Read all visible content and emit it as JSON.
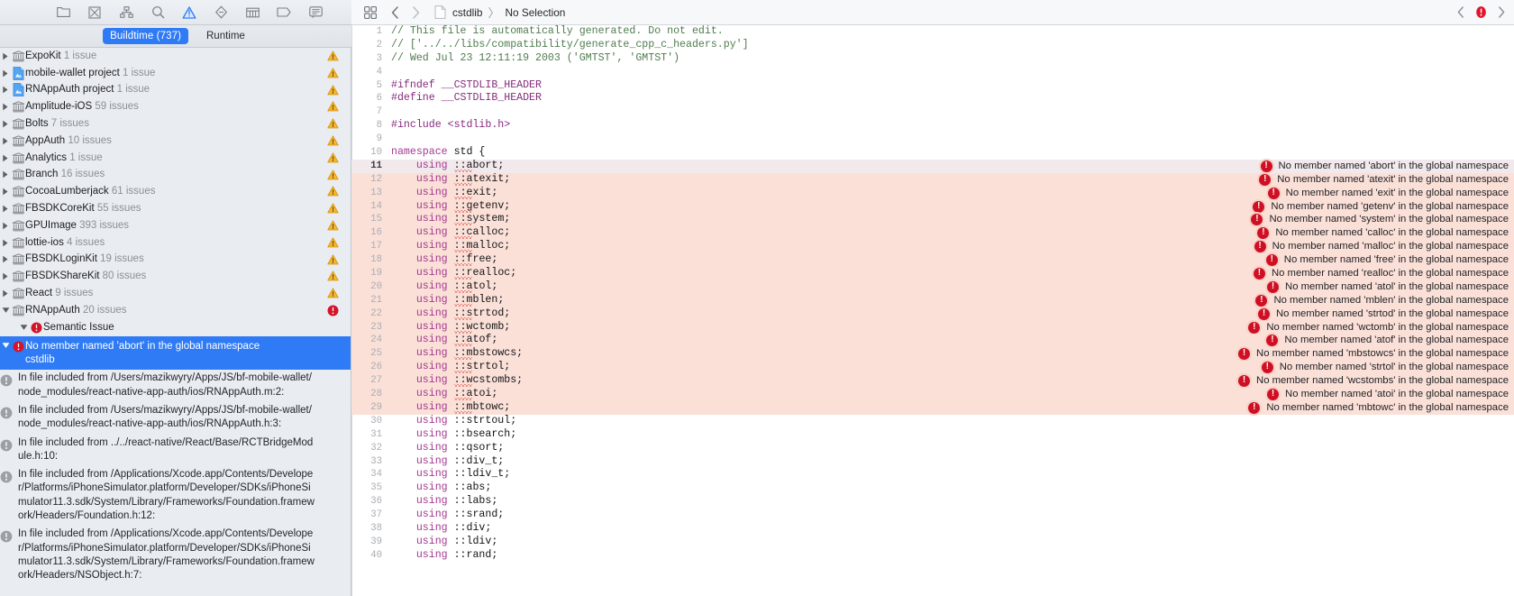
{
  "navigator": {
    "toolbar_icons": [
      {
        "name": "folder-icon",
        "title": "Project navigator"
      },
      {
        "name": "source-control-icon",
        "title": "Source control navigator"
      },
      {
        "name": "symbol-hierarchy-icon",
        "title": "Symbol navigator"
      },
      {
        "name": "search-icon",
        "title": "Find navigator"
      },
      {
        "name": "warning-triangle-icon",
        "title": "Issue navigator"
      },
      {
        "name": "test-diamond-icon",
        "title": "Test navigator"
      },
      {
        "name": "debug-gauge-icon",
        "title": "Debug navigator"
      },
      {
        "name": "breakpoint-tag-icon",
        "title": "Breakpoint navigator"
      },
      {
        "name": "report-bubble-icon",
        "title": "Report navigator"
      }
    ],
    "scope": {
      "buildtime_label": "Buildtime (737)",
      "runtime_label": "Runtime",
      "selected": "Buildtime (737)"
    },
    "groups": [
      {
        "label": "ExpoKit",
        "count": "1 issue",
        "icon": "library-icon",
        "flag": "warning",
        "expanded": false
      },
      {
        "label": "mobile-wallet project",
        "count": "1 issue",
        "icon": "project-icon",
        "flag": "warning",
        "expanded": false
      },
      {
        "label": "RNAppAuth project",
        "count": "1 issue",
        "icon": "project-icon",
        "flag": "warning",
        "expanded": false
      },
      {
        "label": "Amplitude-iOS",
        "count": "59 issues",
        "icon": "library-icon",
        "flag": "warning",
        "expanded": false
      },
      {
        "label": "Bolts",
        "count": "7 issues",
        "icon": "library-icon",
        "flag": "warning",
        "expanded": false
      },
      {
        "label": "AppAuth",
        "count": "10 issues",
        "icon": "library-icon",
        "flag": "warning",
        "expanded": false
      },
      {
        "label": "Analytics",
        "count": "1 issue",
        "icon": "library-icon",
        "flag": "warning",
        "expanded": false
      },
      {
        "label": "Branch",
        "count": "16 issues",
        "icon": "library-icon",
        "flag": "warning",
        "expanded": false
      },
      {
        "label": "CocoaLumberjack",
        "count": "61 issues",
        "icon": "library-icon",
        "flag": "warning",
        "expanded": false
      },
      {
        "label": "FBSDKCoreKit",
        "count": "55 issues",
        "icon": "library-icon",
        "flag": "warning",
        "expanded": false
      },
      {
        "label": "GPUImage",
        "count": "393 issues",
        "icon": "library-icon",
        "flag": "warning",
        "expanded": false
      },
      {
        "label": "lottie-ios",
        "count": "4 issues",
        "icon": "library-icon",
        "flag": "warning",
        "expanded": false
      },
      {
        "label": "FBSDKLoginKit",
        "count": "19 issues",
        "icon": "library-icon",
        "flag": "warning",
        "expanded": false
      },
      {
        "label": "FBSDKShareKit",
        "count": "80 issues",
        "icon": "library-icon",
        "flag": "warning",
        "expanded": false
      },
      {
        "label": "React",
        "count": "9 issues",
        "icon": "library-icon",
        "flag": "warning",
        "expanded": false
      },
      {
        "label": "RNAppAuth",
        "count": "20 issues",
        "icon": "library-icon",
        "flag": "error",
        "expanded": true
      }
    ],
    "issue_group": {
      "label": "Semantic Issue",
      "icon": "error-icon",
      "expanded": true
    },
    "selected_issue": {
      "title": "No member named 'abort' in the global namespace",
      "file": "cstdlib",
      "icon": "error-icon",
      "expanded": true
    },
    "details": [
      "In file included from /Users/mazikwyry/Apps/JS/bf-mobile-wallet/node_modules/react-native-app-auth/ios/RNAppAuth.m:2:",
      "In file included from /Users/mazikwyry/Apps/JS/bf-mobile-wallet/node_modules/react-native-app-auth/ios/RNAppAuth.h:3:",
      "In file included from ../../react-native/React/Base/RCTBridgeModule.h:10:",
      "In file included from /Applications/Xcode.app/Contents/Developer/Platforms/iPhoneSimulator.platform/Developer/SDKs/iPhoneSimulator11.3.sdk/System/Library/Frameworks/Foundation.framework/Headers/Foundation.h:12:",
      "In file included from /Applications/Xcode.app/Contents/Developer/Platforms/iPhoneSimulator.platform/Developer/SDKs/iPhoneSimulator11.3.sdk/System/Library/Frameworks/Foundation.framework/Headers/NSObject.h:7:"
    ]
  },
  "editor": {
    "jumpbar": {
      "grid_icon": "related-items-icon",
      "back_icon": "chevron-left-icon",
      "forward_icon": "chevron-right-icon",
      "doc_icon": "document-icon",
      "file": "cstdlib",
      "separator": "〉",
      "selection": "No Selection",
      "prev_issue_icon": "chevron-left-icon",
      "issue_icon": "error-icon",
      "next_issue_icon": "chevron-right-icon"
    },
    "current_line": 11,
    "lines": [
      {
        "n": 1,
        "text": "// This file is automatically generated. Do not edit.",
        "cls": "cm"
      },
      {
        "n": 2,
        "text": "// ['../../libs/compatibility/generate_cpp_c_headers.py']",
        "cls": "cm"
      },
      {
        "n": 3,
        "text": "// Wed Jul 23 12:11:19 2003 ('GMTST', 'GMTST')",
        "cls": "cm"
      },
      {
        "n": 4,
        "text": "",
        "cls": ""
      },
      {
        "n": 5,
        "text": "#ifndef __CSTDLIB_HEADER",
        "cls": ""
      },
      {
        "n": 6,
        "text": "#define __CSTDLIB_HEADER",
        "cls": ""
      },
      {
        "n": 7,
        "text": "",
        "cls": ""
      },
      {
        "n": 8,
        "text": "#include <stdlib.h>",
        "cls": ""
      },
      {
        "n": 9,
        "text": "",
        "cls": ""
      },
      {
        "n": 10,
        "text": "namespace std {",
        "cls": ""
      },
      {
        "n": 11,
        "text": "    using ::abort;",
        "cls": "",
        "symbol": "abort",
        "error": "No member named 'abort' in the global namespace"
      },
      {
        "n": 12,
        "text": "    using ::atexit;",
        "cls": "",
        "symbol": "atexit",
        "error": "No member named 'atexit' in the global namespace"
      },
      {
        "n": 13,
        "text": "    using ::exit;",
        "cls": "",
        "symbol": "exit",
        "error": "No member named 'exit' in the global namespace"
      },
      {
        "n": 14,
        "text": "    using ::getenv;",
        "cls": "",
        "symbol": "getenv",
        "error": "No member named 'getenv' in the global namespace"
      },
      {
        "n": 15,
        "text": "    using ::system;",
        "cls": "",
        "symbol": "system",
        "error": "No member named 'system' in the global namespace"
      },
      {
        "n": 16,
        "text": "    using ::calloc;",
        "cls": "",
        "symbol": "calloc",
        "error": "No member named 'calloc' in the global namespace"
      },
      {
        "n": 17,
        "text": "    using ::malloc;",
        "cls": "",
        "symbol": "malloc",
        "error": "No member named 'malloc' in the global namespace"
      },
      {
        "n": 18,
        "text": "    using ::free;",
        "cls": "",
        "symbol": "free",
        "error": "No member named 'free' in the global namespace"
      },
      {
        "n": 19,
        "text": "    using ::realloc;",
        "cls": "",
        "symbol": "realloc",
        "error": "No member named 'realloc' in the global namespace"
      },
      {
        "n": 20,
        "text": "    using ::atol;",
        "cls": "",
        "symbol": "atol",
        "error": "No member named 'atol' in the global namespace"
      },
      {
        "n": 21,
        "text": "    using ::mblen;",
        "cls": "",
        "symbol": "mblen",
        "error": "No member named 'mblen' in the global namespace"
      },
      {
        "n": 22,
        "text": "    using ::strtod;",
        "cls": "",
        "symbol": "strtod",
        "error": "No member named 'strtod' in the global namespace"
      },
      {
        "n": 23,
        "text": "    using ::wctomb;",
        "cls": "",
        "symbol": "wctomb",
        "error": "No member named 'wctomb' in the global namespace"
      },
      {
        "n": 24,
        "text": "    using ::atof;",
        "cls": "",
        "symbol": "atof",
        "error": "No member named 'atof' in the global namespace"
      },
      {
        "n": 25,
        "text": "    using ::mbstowcs;",
        "cls": "",
        "symbol": "mbstowcs",
        "error": "No member named 'mbstowcs' in the global namespace"
      },
      {
        "n": 26,
        "text": "    using ::strtol;",
        "cls": "",
        "symbol": "strtol",
        "error": "No member named 'strtol' in the global namespace"
      },
      {
        "n": 27,
        "text": "    using ::wcstombs;",
        "cls": "",
        "symbol": "wcstombs",
        "error": "No member named 'wcstombs' in the global namespace"
      },
      {
        "n": 28,
        "text": "    using ::atoi;",
        "cls": "",
        "symbol": "atoi",
        "error": "No member named 'atoi' in the global namespace"
      },
      {
        "n": 29,
        "text": "    using ::mbtowc;",
        "cls": "",
        "symbol": "mbtowc",
        "error": "No member named 'mbtowc' in the global namespace"
      },
      {
        "n": 30,
        "text": "    using ::strtoul;",
        "cls": ""
      },
      {
        "n": 31,
        "text": "    using ::bsearch;",
        "cls": ""
      },
      {
        "n": 32,
        "text": "    using ::qsort;",
        "cls": ""
      },
      {
        "n": 33,
        "text": "    using ::div_t;",
        "cls": ""
      },
      {
        "n": 34,
        "text": "    using ::ldiv_t;",
        "cls": ""
      },
      {
        "n": 35,
        "text": "    using ::abs;",
        "cls": ""
      },
      {
        "n": 36,
        "text": "    using ::labs;",
        "cls": ""
      },
      {
        "n": 37,
        "text": "    using ::srand;",
        "cls": ""
      },
      {
        "n": 38,
        "text": "    using ::div;",
        "cls": ""
      },
      {
        "n": 39,
        "text": "    using ::ldiv;",
        "cls": ""
      },
      {
        "n": 40,
        "text": "    using ::rand;",
        "cls": ""
      }
    ]
  },
  "colors": {
    "accent": "#2f7bf6",
    "error": "#cf1024",
    "warning": "#f5ae1b",
    "error_line_bg": "#fbe0d8",
    "current_line_bg": "#f2e9ec",
    "navigator_bg": "#e9edf1"
  }
}
